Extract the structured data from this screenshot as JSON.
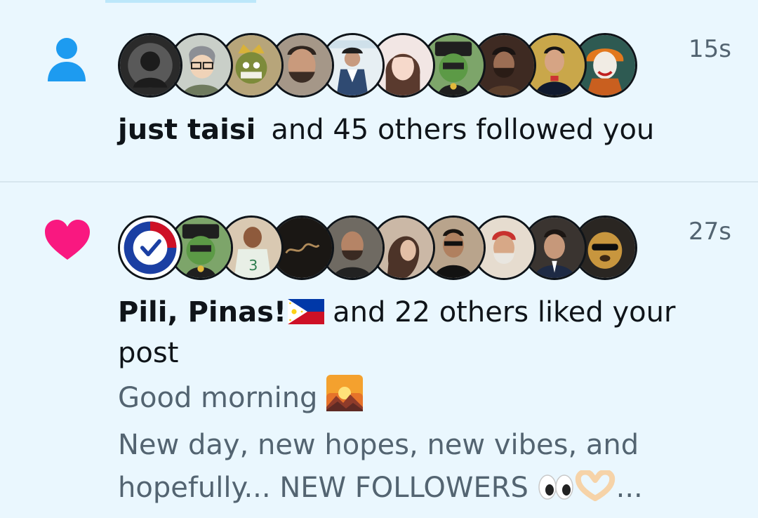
{
  "notifications": [
    {
      "type": "follow",
      "icon": "person-icon",
      "time": "15s",
      "actor_name": "just taisi",
      "action_text": "and 45 others followed you",
      "avatar_count": 10
    },
    {
      "type": "like",
      "icon": "heart-icon",
      "time": "27s",
      "actor_name": "Pili, Pinas!",
      "actor_flag": "philippines-flag",
      "action_text": "and 22 others liked your post",
      "avatar_count": 10,
      "post_lines": [
        "Good morning",
        "New day, new hopes, new vibes, and",
        "hopefully... NEW FOLLOWERS"
      ],
      "post_emojis": [
        "sunrise-over-mountains-emoji",
        "eyes-emoji",
        "heart-hands-emoji"
      ],
      "post_ellipsis": "..."
    }
  ],
  "colors": {
    "background": "#EAF7FE",
    "follow_icon": "#1D9BF0",
    "heart_icon": "#F91880",
    "primary_text": "#0F1419",
    "secondary_text": "#536471"
  }
}
